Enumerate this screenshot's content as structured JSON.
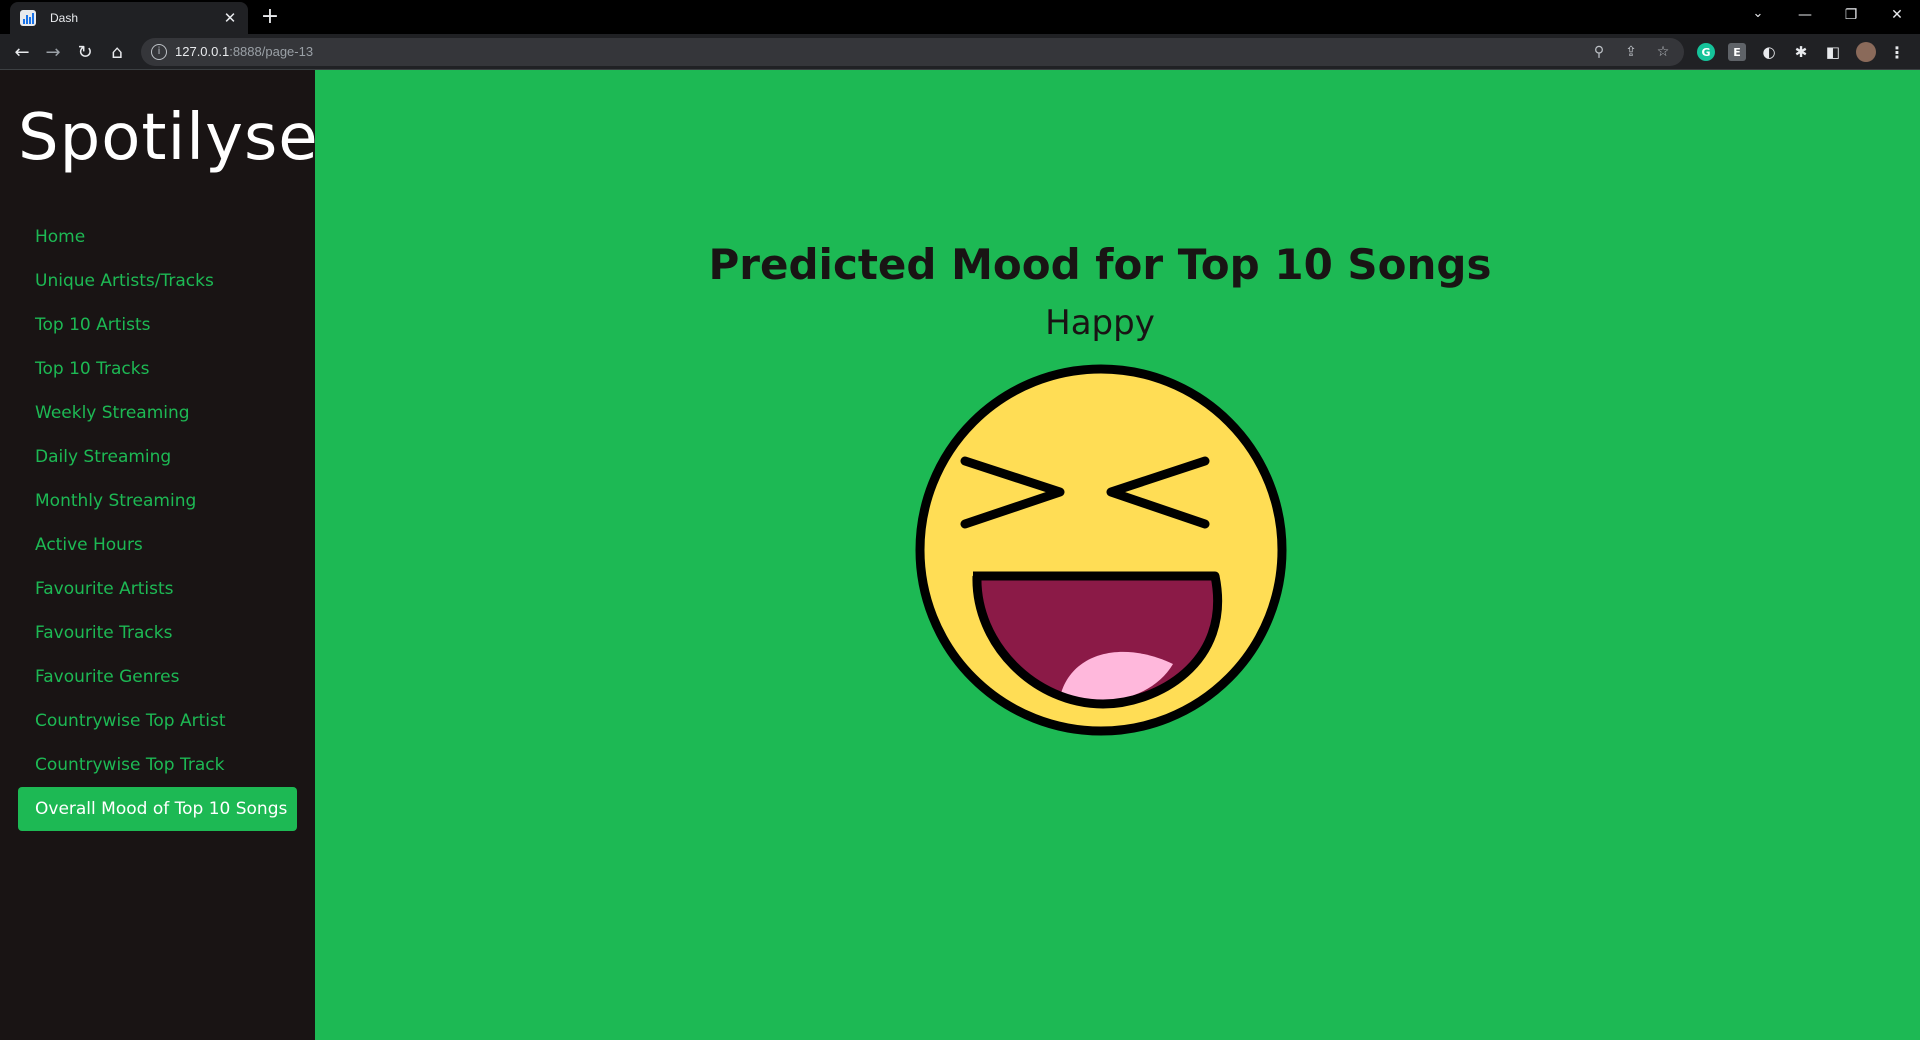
{
  "browser": {
    "tab_title": "Dash",
    "url_host": "127.0.0.1",
    "url_rest": ":8888/page-13"
  },
  "sidebar": {
    "brand": "Spotilyser",
    "items": [
      {
        "label": "Home",
        "active": false
      },
      {
        "label": "Unique Artists/Tracks",
        "active": false
      },
      {
        "label": "Top 10 Artists",
        "active": false
      },
      {
        "label": "Top 10 Tracks",
        "active": false
      },
      {
        "label": "Weekly Streaming",
        "active": false
      },
      {
        "label": "Daily Streaming",
        "active": false
      },
      {
        "label": "Monthly Streaming",
        "active": false
      },
      {
        "label": "Active Hours",
        "active": false
      },
      {
        "label": "Favourite Artists",
        "active": false
      },
      {
        "label": "Favourite Tracks",
        "active": false
      },
      {
        "label": "Favourite Genres",
        "active": false
      },
      {
        "label": "Countrywise Top Artist",
        "active": false
      },
      {
        "label": "Countrywise Top Track",
        "active": false
      },
      {
        "label": "Overall Mood of Top 10 Songs",
        "active": true
      }
    ]
  },
  "main": {
    "title": "Predicted Mood for Top 10 Songs",
    "mood": "Happy",
    "emoji_icon": "laughing-face-icon"
  },
  "colors": {
    "accent": "#1DB954",
    "sidebar_bg": "#191414",
    "emoji_face": "#FFDD55",
    "emoji_mouth": "#8B1A47",
    "emoji_tongue": "#FFB8DC"
  }
}
